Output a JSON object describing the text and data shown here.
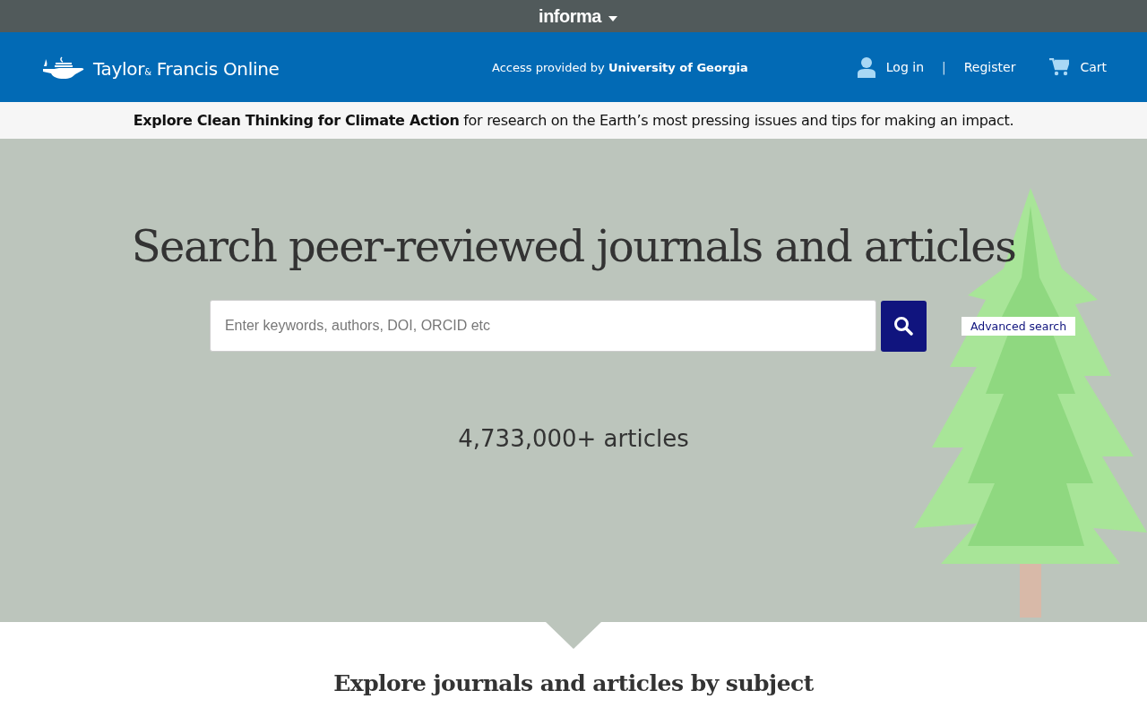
{
  "top_bar": {
    "brand": "informa"
  },
  "header": {
    "logo": {
      "name_1": "Taylor",
      "ampersand": "&",
      "name_2": "Francis Online"
    },
    "access_prefix": "Access provided by",
    "institution": "University of Georgia",
    "login": "Log in",
    "separator": "|",
    "register": "Register",
    "cart": "Cart"
  },
  "announcement": "**Explore Clean Thinking for Climate Action** for research on the Earth’s most pressing issues and tips for making an impact.",
  "hero": {
    "title": "Search peer-reviewed journals and articles",
    "search": {
      "placeholder": "Enter keywords, authors, DOI, ORCID etc"
    },
    "advanced_search": "Advanced search",
    "count": "4,733,000+ articles"
  },
  "subjects": {
    "title": "Explore journals and articles by subject"
  }
}
